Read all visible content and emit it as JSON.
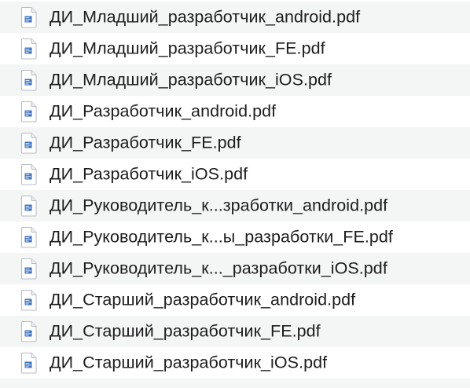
{
  "file_list": {
    "icon_name": "pdf-document-icon",
    "items": [
      {
        "name": "ДИ_Младший_разработчик_android.pdf"
      },
      {
        "name": "ДИ_Младший_разработчик_FE.pdf"
      },
      {
        "name": "ДИ_Младший_разработчик_iOS.pdf"
      },
      {
        "name": "ДИ_Разработчик_android.pdf"
      },
      {
        "name": "ДИ_Разработчик_FE.pdf"
      },
      {
        "name": "ДИ_Разработчик_iOS.pdf"
      },
      {
        "name": "ДИ_Руководитель_к...зработки_android.pdf"
      },
      {
        "name": "ДИ_Руководитель_к...ы_разработки_FE.pdf"
      },
      {
        "name": "ДИ_Руководитель_к..._разработки_iOS.pdf"
      },
      {
        "name": "ДИ_Старший_разработчик_android.pdf"
      },
      {
        "name": "ДИ_Старший_разработчик_FE.pdf"
      },
      {
        "name": "ДИ_Старший_разработчик_iOS.pdf"
      }
    ]
  }
}
